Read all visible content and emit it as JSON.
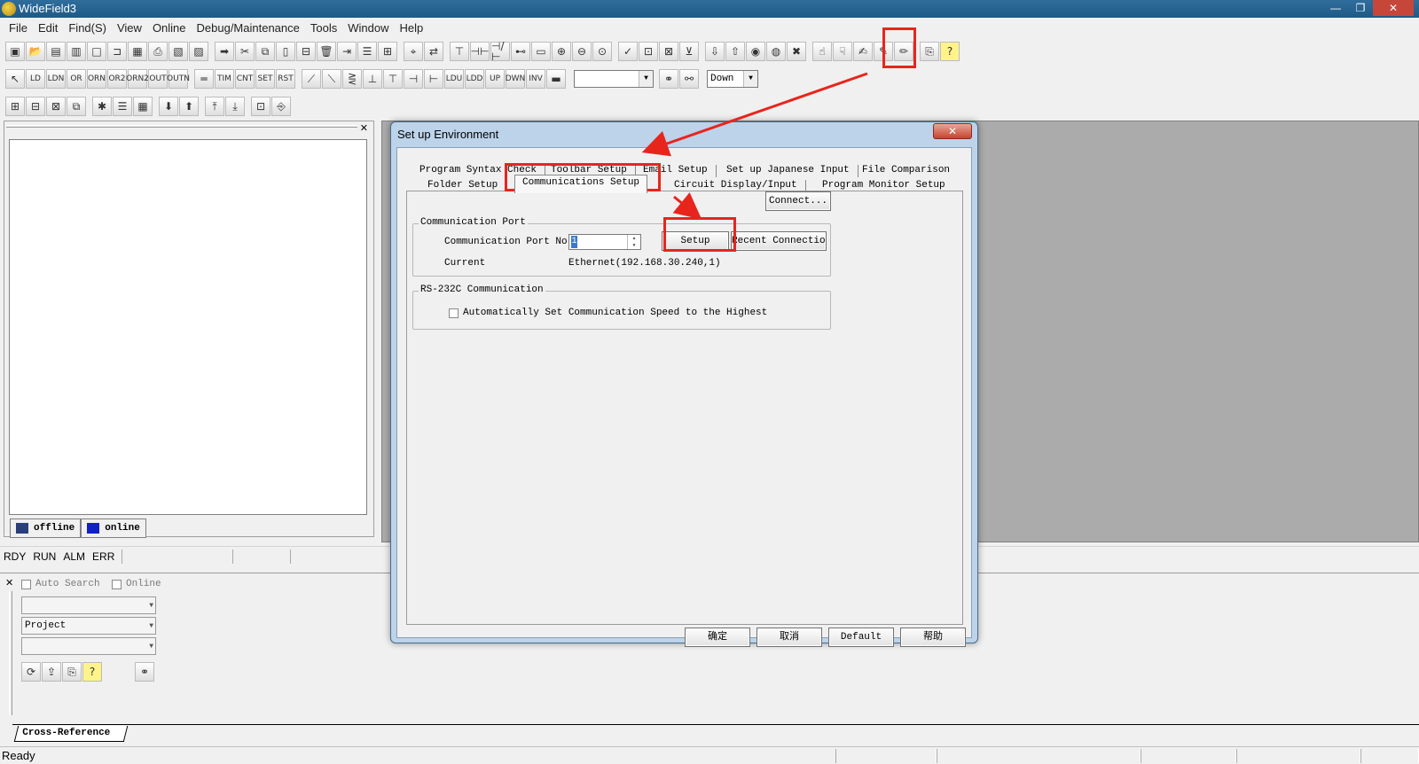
{
  "window": {
    "title": "WideField3",
    "minimize": "—",
    "restore": "❐",
    "close": "✕"
  },
  "menu": [
    "File",
    "Edit",
    "Find(S)",
    "View",
    "Online",
    "Debug/Maintenance",
    "Tools",
    "Window",
    "Help"
  ],
  "toolbar2": {
    "buttons": [
      "LD",
      "LDN",
      "OR",
      "ORN",
      "OR2",
      "ORN2",
      "OUT",
      "OUTN",
      "TIM",
      "CNT",
      "SET",
      "RST",
      "LDU",
      "LDD",
      "UP",
      "DWN",
      "INV"
    ],
    "direction": {
      "value": "Down"
    }
  },
  "left_panel": {
    "close": "✕",
    "tabs": [
      {
        "label": "offline",
        "color": "#2a3f7a"
      },
      {
        "label": "online",
        "color": "#1020c8"
      }
    ]
  },
  "indicators": [
    "RDY",
    "RUN",
    "ALM",
    "ERR"
  ],
  "cross_ref": {
    "close": "✕",
    "auto_search": "Auto Search",
    "online": "Online",
    "combo_project": "Project",
    "tab": "Cross-Reference"
  },
  "status": {
    "ready": "Ready"
  },
  "dialog": {
    "title": "Set up Environment",
    "close": "✕",
    "tabs_row1": [
      "Program Syntax Check",
      "Toolbar Setup",
      "Email Setup",
      "Set up Japanese Input",
      "File Comparison"
    ],
    "tabs_row2": [
      "Folder Setup",
      "Communications Setup",
      "Circuit Display/Input",
      "Program Monitor Setup"
    ],
    "active_tab": "Communications Setup",
    "connect_button": "Connect...",
    "comm_port": {
      "legend": "Communication Port",
      "port_label": "Communication Port No.",
      "port_value": "1",
      "setup_button": "Setup",
      "recent_button": "Recent Connections",
      "current_label": "Current",
      "current_value": "Ethernet(192.168.30.240,1)"
    },
    "rs232c": {
      "legend": "RS-232C Communication",
      "auto_speed": "Automatically Set Communication Speed to the Highest"
    },
    "buttons": {
      "ok": "确定",
      "cancel": "取消",
      "default": "Default",
      "help": "帮助"
    }
  },
  "annotation_color": "#e8251d"
}
